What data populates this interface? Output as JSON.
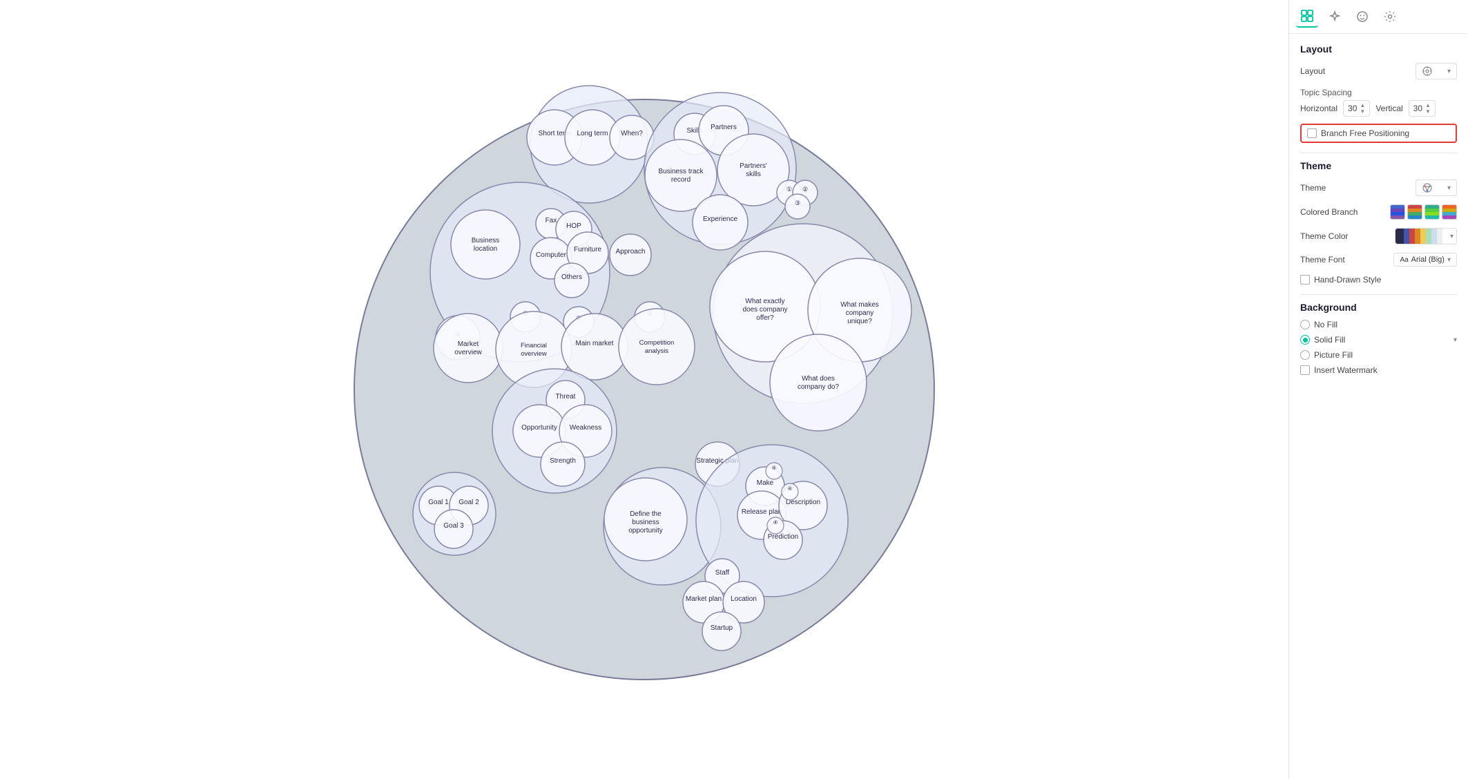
{
  "panel": {
    "tabs": [
      {
        "id": "layout",
        "icon": "⊞",
        "active": true
      },
      {
        "id": "ai",
        "icon": "✦",
        "active": false
      },
      {
        "id": "face",
        "icon": "☺",
        "active": false
      },
      {
        "id": "settings",
        "icon": "⚙",
        "active": false
      }
    ],
    "layout": {
      "section_title": "Layout",
      "layout_label": "Layout",
      "topic_spacing_label": "Topic Spacing",
      "horizontal_label": "Horizontal",
      "horizontal_value": "30",
      "vertical_label": "Vertical",
      "vertical_value": "30",
      "branch_free_label": "Branch Free Positioning"
    },
    "theme": {
      "section_title": "Theme",
      "theme_label": "Theme",
      "colored_branch_label": "Colored Branch",
      "theme_color_label": "Theme Color",
      "theme_font_label": "Theme Font",
      "theme_font_value": "Arial (Big)",
      "hand_drawn_label": "Hand-Drawn Style"
    },
    "background": {
      "section_title": "Background",
      "no_fill_label": "No Fill",
      "solid_fill_label": "Solid Fill",
      "picture_fill_label": "Picture Fill",
      "insert_watermark_label": "Insert Watermark"
    }
  },
  "mindmap": {
    "nodes": [
      {
        "id": "short-term",
        "label": "Short term"
      },
      {
        "id": "long-term",
        "label": "Long term"
      },
      {
        "id": "when",
        "label": "When?"
      },
      {
        "id": "skills",
        "label": "Skills"
      },
      {
        "id": "partners",
        "label": "Partners"
      },
      {
        "id": "business-track",
        "label": "Business track record"
      },
      {
        "id": "partners-skills",
        "label": "Partners' skills"
      },
      {
        "id": "experience",
        "label": "Experience"
      },
      {
        "id": "fax",
        "label": "Fax"
      },
      {
        "id": "hop",
        "label": "HOP"
      },
      {
        "id": "computer",
        "label": "Computer"
      },
      {
        "id": "furniture",
        "label": "Furniture"
      },
      {
        "id": "approach",
        "label": "Approach"
      },
      {
        "id": "others",
        "label": "Others"
      },
      {
        "id": "business-location",
        "label": "Business location"
      },
      {
        "id": "market-overview",
        "label": "Market overview"
      },
      {
        "id": "financial-overview",
        "label": "Financial overview"
      },
      {
        "id": "main-market",
        "label": "Main market"
      },
      {
        "id": "competition",
        "label": "Competition analysis"
      },
      {
        "id": "threat",
        "label": "Threat"
      },
      {
        "id": "opportunity",
        "label": "Opportunity"
      },
      {
        "id": "weakness",
        "label": "Weakness"
      },
      {
        "id": "strength",
        "label": "Strength"
      },
      {
        "id": "what-offer",
        "label": "What exactly does company offer?"
      },
      {
        "id": "what-unique",
        "label": "What makes company unique?"
      },
      {
        "id": "what-do",
        "label": "What does company do?"
      },
      {
        "id": "strategic-plan",
        "label": "Strategic plan"
      },
      {
        "id": "make",
        "label": "Make"
      },
      {
        "id": "release-plan",
        "label": "Release plan"
      },
      {
        "id": "description",
        "label": "Description"
      },
      {
        "id": "prediction",
        "label": "Prediction"
      },
      {
        "id": "define-opportunity",
        "label": "Define the business opportunity"
      },
      {
        "id": "goal1",
        "label": "Goal 1"
      },
      {
        "id": "goal2",
        "label": "Goal 2"
      },
      {
        "id": "goal3",
        "label": "Goal 3"
      },
      {
        "id": "staff",
        "label": "Staff"
      },
      {
        "id": "market-plan",
        "label": "Market plan"
      },
      {
        "id": "location",
        "label": "Location"
      },
      {
        "id": "startup",
        "label": "Startup"
      }
    ]
  }
}
